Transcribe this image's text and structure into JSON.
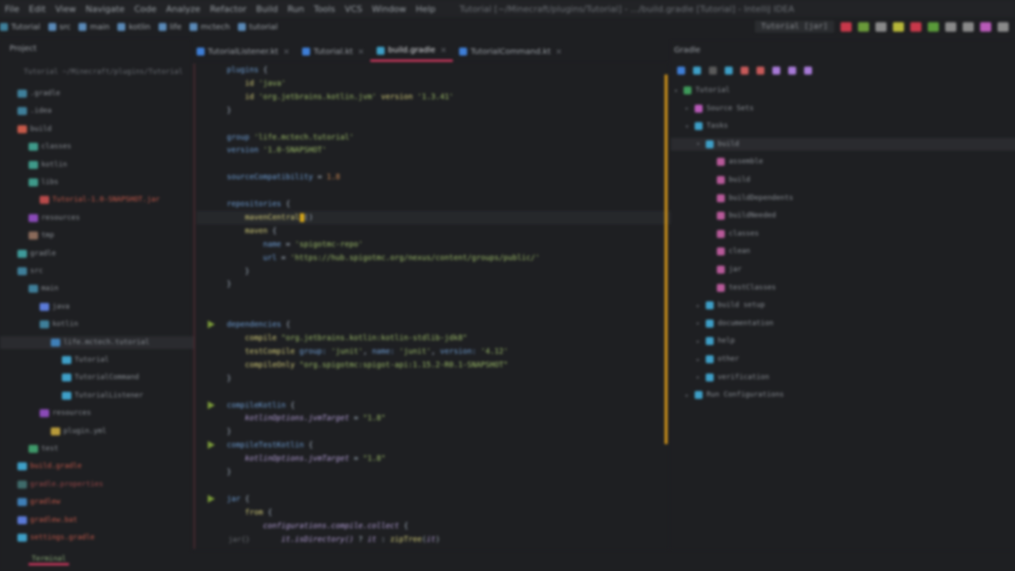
{
  "menu": [
    "File",
    "Edit",
    "View",
    "Navigate",
    "Code",
    "Analyze",
    "Refactor",
    "Build",
    "Run",
    "Tools",
    "VCS",
    "Window",
    "Help"
  ],
  "window_title": "Tutorial [~/Minecraft/plugins/Tutorial] - .../build.gradle [Tutorial] - IntelliJ IDEA",
  "run_config": "Tutorial [jar]",
  "breadcrumbs": [
    "Tutorial",
    "src",
    "main",
    "kotlin",
    "life",
    "mctech",
    "tutorial"
  ],
  "project": {
    "title": "Project",
    "path": "Tutorial ~/Minecraft/plugins/Tutorial"
  },
  "tree": [
    {
      "label": ".gradle",
      "indent": 1,
      "color": "#3f7f9a"
    },
    {
      "label": ".idea",
      "indent": 1,
      "color": "#3f7f9a"
    },
    {
      "label": "build",
      "indent": 1,
      "color": "#c85a4a"
    },
    {
      "label": "classes",
      "indent": 2,
      "color": "#3f9a8a"
    },
    {
      "label": "kotlin",
      "indent": 2,
      "color": "#3f9a8a"
    },
    {
      "label": "libs",
      "indent": 2,
      "color": "#3f9a8a"
    },
    {
      "label": "Tutorial-1.0-SNAPSHOT.jar",
      "indent": 3,
      "color": "#b84a4a",
      "accent": "#c85a4a"
    },
    {
      "label": "resources",
      "indent": 2,
      "color": "#8a4ab8"
    },
    {
      "label": "tmp",
      "indent": 2,
      "color": "#8a6a5a"
    },
    {
      "label": "gradle",
      "indent": 1,
      "color": "#3f9a9a"
    },
    {
      "label": "src",
      "indent": 1,
      "color": "#3f7f9a"
    },
    {
      "label": "main",
      "indent": 2,
      "color": "#3f7f9a"
    },
    {
      "label": "java",
      "indent": 3,
      "color": "#5a7ad8"
    },
    {
      "label": "kotlin",
      "indent": 3,
      "color": "#3f7f9a"
    },
    {
      "label": "life.mctech.tutorial",
      "indent": 4,
      "color": "#3f7fb8",
      "sel": true
    },
    {
      "label": "Tutorial",
      "indent": 5,
      "color": "#3fa0c8"
    },
    {
      "label": "TutorialCommand",
      "indent": 5,
      "color": "#3fa0c8"
    },
    {
      "label": "TutorialListener",
      "indent": 5,
      "color": "#3fa0c8"
    },
    {
      "label": "resources",
      "indent": 3,
      "color": "#8a4ab8"
    },
    {
      "label": "plugin.yml",
      "indent": 4,
      "color": "#b89a3a"
    },
    {
      "label": "test",
      "indent": 2,
      "color": "#3f9a6a"
    },
    {
      "label": "build.gradle",
      "indent": 1,
      "color": "#3fa0c8",
      "accent": "#c85a4a"
    },
    {
      "label": "gradle.properties",
      "indent": 1,
      "color": "#3f6a6a",
      "accent": "#a04a4a"
    },
    {
      "label": "gradlew",
      "indent": 1,
      "color": "#3f7fb8",
      "accent": "#c85a4a"
    },
    {
      "label": "gradlew.bat",
      "indent": 1,
      "color": "#5a7ad8",
      "accent": "#c85a4a"
    },
    {
      "label": "settings.gradle",
      "indent": 1,
      "color": "#3fa0c8",
      "accent": "#c85a4a"
    }
  ],
  "tabs": [
    {
      "label": "TutorialListener.kt",
      "color": "#3f7fd8",
      "active": false
    },
    {
      "label": "Tutorial.kt",
      "color": "#3f7fd8",
      "active": false
    },
    {
      "label": "build.gradle",
      "color": "#3fa0c8",
      "active": true
    },
    {
      "label": "TutorialCommand.kt",
      "color": "#3f7fd8",
      "active": false
    }
  ],
  "code": [
    [
      [
        "k",
        "plugins "
      ],
      [
        "p",
        "{"
      ]
    ],
    [
      [
        "p",
        "    "
      ],
      [
        "f",
        "id "
      ],
      [
        "s",
        "'java'"
      ]
    ],
    [
      [
        "p",
        "    "
      ],
      [
        "f",
        "id "
      ],
      [
        "s",
        "'org.jetbrains.kotlin.jvm' "
      ],
      [
        "f",
        "version "
      ],
      [
        "s",
        "'1.3.41'"
      ]
    ],
    [
      [
        "p",
        "}"
      ]
    ],
    [],
    [
      [
        "k",
        "group "
      ],
      [
        "s",
        "'life.mctech.tutorial'"
      ]
    ],
    [
      [
        "k",
        "version "
      ],
      [
        "s",
        "'1.0-SNAPSHOT'"
      ]
    ],
    [],
    [
      [
        "k",
        "sourceCompatibility "
      ],
      [
        "p",
        "= "
      ],
      [
        "n",
        "1.8"
      ]
    ],
    [],
    [
      [
        "k",
        "repositories "
      ],
      [
        "p",
        "{"
      ]
    ],
    [
      [
        "p",
        "    "
      ],
      [
        "f",
        "mavenCentral"
      ],
      [
        "p",
        "()"
      ]
    ],
    [
      [
        "p",
        "    "
      ],
      [
        "f",
        "maven "
      ],
      [
        "p",
        "{"
      ]
    ],
    [
      [
        "p",
        "        "
      ],
      [
        "k",
        "name "
      ],
      [
        "p",
        "= "
      ],
      [
        "s",
        "'spigotmc-repo'"
      ]
    ],
    [
      [
        "p",
        "        "
      ],
      [
        "k",
        "url "
      ],
      [
        "p",
        "= "
      ],
      [
        "s",
        "'https://hub.spigotmc.org/nexus/content/groups/public/'"
      ]
    ],
    [
      [
        "p",
        "    }"
      ]
    ],
    [
      [
        "p",
        "}"
      ]
    ],
    [],
    [],
    [
      [
        "k",
        "dependencies "
      ],
      [
        "p",
        "{"
      ]
    ],
    [
      [
        "p",
        "    "
      ],
      [
        "f",
        "compile "
      ],
      [
        "s",
        "\"org.jetbrains.kotlin:kotlin-stdlib-jdk8\""
      ]
    ],
    [
      [
        "p",
        "    "
      ],
      [
        "f",
        "testCompile "
      ],
      [
        "k",
        "group: "
      ],
      [
        "s",
        "'junit'"
      ],
      [
        "p",
        ", "
      ],
      [
        "k",
        "name: "
      ],
      [
        "s",
        "'junit'"
      ],
      [
        "p",
        ", "
      ],
      [
        "k",
        "version: "
      ],
      [
        "s",
        "'4.12'"
      ]
    ],
    [
      [
        "p",
        "    "
      ],
      [
        "f",
        "compileOnly "
      ],
      [
        "s",
        "\"org.spigotmc:spigot-api:1.15.2-R0.1-SNAPSHOT\""
      ]
    ],
    [
      [
        "p",
        "}"
      ]
    ],
    [],
    [
      [
        "k",
        "compileKotlin "
      ],
      [
        "p",
        "{"
      ]
    ],
    [
      [
        "p",
        "    "
      ],
      [
        "i",
        "kotlinOptions.jvmTarget "
      ],
      [
        "p",
        "= "
      ],
      [
        "s",
        "\"1.8\""
      ]
    ],
    [
      [
        "p",
        "}"
      ]
    ],
    [
      [
        "k",
        "compileTestKotlin "
      ],
      [
        "p",
        "{"
      ]
    ],
    [
      [
        "p",
        "    "
      ],
      [
        "i",
        "kotlinOptions.jvmTarget "
      ],
      [
        "p",
        "= "
      ],
      [
        "s",
        "\"1.8\""
      ]
    ],
    [
      [
        "p",
        "}"
      ]
    ],
    [],
    [
      [
        "k",
        "jar "
      ],
      [
        "p",
        "{"
      ]
    ],
    [
      [
        "p",
        "    "
      ],
      [
        "f",
        "from "
      ],
      [
        "p",
        "{"
      ]
    ],
    [
      [
        "p",
        "        "
      ],
      [
        "i",
        "configurations.compile.collect "
      ],
      [
        "p",
        "{"
      ]
    ],
    [
      [
        "p",
        "            "
      ],
      [
        "i",
        "it.isDirectory() "
      ],
      [
        "p",
        "? "
      ],
      [
        "i",
        "it "
      ],
      [
        "p",
        ": "
      ],
      [
        "f",
        "zipTree"
      ],
      [
        "p",
        "("
      ],
      [
        "i",
        "it"
      ],
      [
        "p",
        ")"
      ]
    ]
  ],
  "editor_status": "jar{}",
  "gradle": {
    "title": "Gradle"
  },
  "gradle_tree": [
    {
      "label": "Tutorial",
      "indent": 0,
      "color": "#3f9a5a",
      "arrow": "▾"
    },
    {
      "label": "Source Sets",
      "indent": 1,
      "color": "#b85ab8",
      "arrow": "▸"
    },
    {
      "label": "Tasks",
      "indent": 1,
      "color": "#3fa0c8",
      "arrow": "▾"
    },
    {
      "label": "build",
      "indent": 2,
      "color": "#3fa0c8",
      "arrow": "▾",
      "sel": true
    },
    {
      "label": "assemble",
      "indent": 3,
      "color": "#b85a9a",
      "arrow": ""
    },
    {
      "label": "build",
      "indent": 3,
      "color": "#b85a9a",
      "arrow": ""
    },
    {
      "label": "buildDependents",
      "indent": 3,
      "color": "#b85a9a",
      "arrow": ""
    },
    {
      "label": "buildNeeded",
      "indent": 3,
      "color": "#b85a9a",
      "arrow": ""
    },
    {
      "label": "classes",
      "indent": 3,
      "color": "#b85a9a",
      "arrow": ""
    },
    {
      "label": "clean",
      "indent": 3,
      "color": "#b85a9a",
      "arrow": ""
    },
    {
      "label": "jar",
      "indent": 3,
      "color": "#b85a9a",
      "arrow": ""
    },
    {
      "label": "testClasses",
      "indent": 3,
      "color": "#b85a9a",
      "arrow": ""
    },
    {
      "label": "build setup",
      "indent": 2,
      "color": "#3fa0c8",
      "arrow": "▸"
    },
    {
      "label": "documentation",
      "indent": 2,
      "color": "#3fa0c8",
      "arrow": "▸"
    },
    {
      "label": "help",
      "indent": 2,
      "color": "#3fa0c8",
      "arrow": "▸"
    },
    {
      "label": "other",
      "indent": 2,
      "color": "#3fa0c8",
      "arrow": "▸"
    },
    {
      "label": "verification",
      "indent": 2,
      "color": "#3fa0c8",
      "arrow": "▸"
    },
    {
      "label": "Run Configurations",
      "indent": 1,
      "color": "#3fa0c8",
      "arrow": "▸"
    }
  ],
  "gradle_tool_colors": [
    "#3f7fd8",
    "#3fa0c8",
    "#5a5a5a",
    "#3fa0c8",
    "#c85a5a",
    "#c85a5a",
    "#a87ad8",
    "#a87ad8",
    "#a87ad8"
  ],
  "toolbar_colors": [
    "#c8384a",
    "#6a9a3a",
    "#8a8a8a",
    "#b8b83a",
    "#c8384a",
    "#5a9a3a",
    "#8a8a8a",
    "#8a8a8a",
    "#b85ab8",
    "#8a8a8a"
  ],
  "bottom_tab": "Terminal"
}
